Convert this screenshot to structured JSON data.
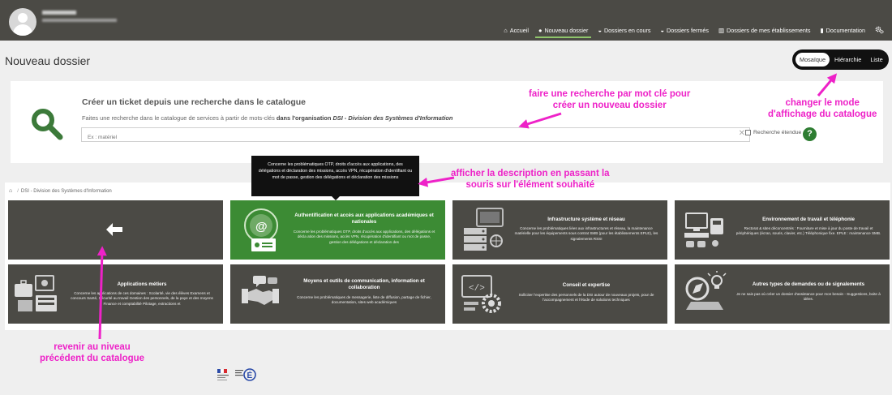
{
  "header": {
    "nav": [
      {
        "icon": "home-icon",
        "glyph": "⌂",
        "label": "Accueil",
        "active": false
      },
      {
        "icon": "circle-plus-icon",
        "glyph": "●",
        "label": "Nouveau dossier",
        "active": true
      },
      {
        "icon": "chat-icon",
        "glyph": "◒",
        "label": "Dossiers en cours",
        "active": false
      },
      {
        "icon": "chat-icon",
        "glyph": "◒",
        "label": "Dossiers fermés",
        "active": false
      },
      {
        "icon": "building-icon",
        "glyph": "▥",
        "label": "Dossiers de mes établissements",
        "active": false
      },
      {
        "icon": "book-icon",
        "glyph": "▮",
        "label": "Documentation",
        "active": false
      }
    ],
    "settings_icon": "gears-icon"
  },
  "page": {
    "title": "Nouveau dossier",
    "view_modes": [
      {
        "label": "Mosaïque",
        "active": true
      },
      {
        "label": "Hiérarchie",
        "active": false
      },
      {
        "label": "Liste",
        "active": false
      }
    ]
  },
  "search_card": {
    "title": "Créer un ticket depuis une recherche dans le catalogue",
    "desc_prefix": "Faites une recherche dans le catalogue de services à partir de mots-clés ",
    "desc_bold": "dans l'organisation ",
    "desc_italic": "DSI - Division des Systèmes d'Information",
    "placeholder": "Ex : matériel",
    "clear": "✕",
    "checkbox_label": "Recherche étendue",
    "help": "?"
  },
  "catalog": {
    "breadcrumb": "DSI - Division des Systèmes d'Information",
    "back_glyph": "🡐",
    "tiles": [
      {
        "title": "Authentification et accès aux applications académiques et nationales",
        "desc": "Concerne les problématiques OTP, droits d'accès aux applications, des délégations et décla  ation des missions, accès VPN, récupération d'identifiant ou mot de passe, gestion des délégations et déclaration des"
      },
      {
        "title": "Infrastructure système et réseau",
        "desc": "Concerne les problématiques liées aux infrastructures et réseau, la maintenance matérielle pour les équipements sous contrat SMB (pour les établissements EPLE), les signalements RSSI"
      },
      {
        "title": "Environnement de travail et téléphonie",
        "desc": "Rectorat & sites déconcentrés : Fourniture et mise à jour du poste de travail et périphériques (écran, souris, clavier, etc.) Téléphonique fixe. EPLE : maintenance SMB."
      },
      {
        "title": "Applications métiers",
        "desc": "Concerne les applications de ces domaines : Scolarité, vie des élèves Examens et concours Santé, Sécurité au travail Gestion des personnels, de la paye et des moyens Finance et comptabilité Pilotage, extractions et"
      },
      {
        "title": "Moyens et outils de communication, information et collaboration",
        "desc": "Concerne les problématiques de messagerie, liste de diffusion, partage de fichier, documentation, sites web académiques"
      },
      {
        "title": "Conseil et expertise",
        "desc": "Solliciter l'expertise des personnels de la DSI autour de nouveaux projets, pour de l'accompagnement et l'étude de solutions techniques"
      },
      {
        "title": "Autres types de demandes ou de signalements",
        "desc": "Je ne sais pas où créer un dossier d'assistance pour mon besoin - Suggestions, boite à idées."
      }
    ],
    "tooltip": "Concerne les problématiques OTP, droits d'accès aux applications, des délégations et déclaration des missions, accès VPN, récupération d'identifiant ou mot de passe, gestion des délégations et déclaration des missions"
  },
  "annotations": {
    "search": "faire une recherche par mot clé pour\ncréer un nouveau dossier",
    "view_mode": "changer le mode\nd'affichage du catalogue",
    "tooltip": "afficher la description en passant la\nsouris sur l'élément souhaité",
    "back": "revenir au niveau\nprécédent du catalogue"
  },
  "colors": {
    "header_bg": "#4b4a45",
    "tile_bg": "#4b4a45",
    "tile_active": "#3c8b34",
    "search_icon": "#3c7a3a",
    "annotation": "#ee22c8"
  }
}
